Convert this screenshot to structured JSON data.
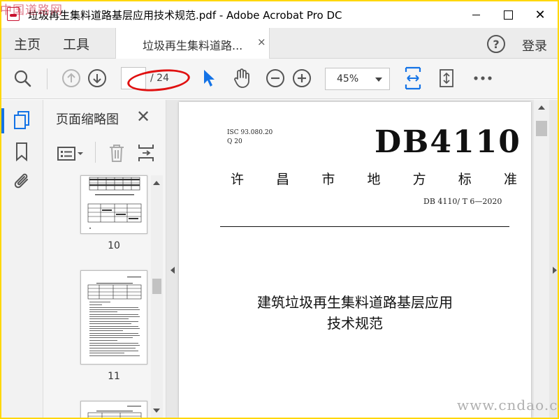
{
  "watermarks": {
    "top_left": "中国道路网",
    "bottom_right": "www.cndao.com"
  },
  "window": {
    "title": "垃圾再生集料道路基层应用技术规范.pdf - Adobe Acrobat Pro DC",
    "minimize_glyph": "",
    "maximize_glyph": "",
    "close_glyph": "✕"
  },
  "tabs": {
    "home": "主页",
    "tools": "工具",
    "document": "垃圾再生集料道路...",
    "document_close": "×",
    "help": "?",
    "login": "登录"
  },
  "toolbar": {
    "icons": [
      "search-icon",
      "page-up-icon",
      "page-down-icon",
      "select-pointer-icon",
      "hand-tool-icon",
      "zoom-out-icon",
      "zoom-in-icon",
      "fit-width-icon",
      "rotate-page-icon",
      "more-icon"
    ],
    "current_page": "",
    "total_pages": "/ 24",
    "zoom": "45%",
    "accent_color": "#1473e6"
  },
  "left_nav": {
    "icons": [
      "page-thumbnails-icon",
      "bookmark-icon",
      "attachment-icon"
    ]
  },
  "thumbnails_panel": {
    "title": "页面缩略图",
    "close": "✕",
    "pages": [
      {
        "number": "10"
      },
      {
        "number": "11"
      }
    ]
  },
  "document_page": {
    "ics_line1": "ISC 93.080.20",
    "ics_line2": "Q  20",
    "code": "DB4110",
    "standard_type_chars": [
      "许",
      "昌",
      "市",
      "地",
      "方",
      "标",
      "准"
    ],
    "standard_number": "DB 4110/ T 6—2020",
    "title_line1": "建筑垃圾再生集料道路基层应用",
    "title_line2": "技术规范"
  }
}
